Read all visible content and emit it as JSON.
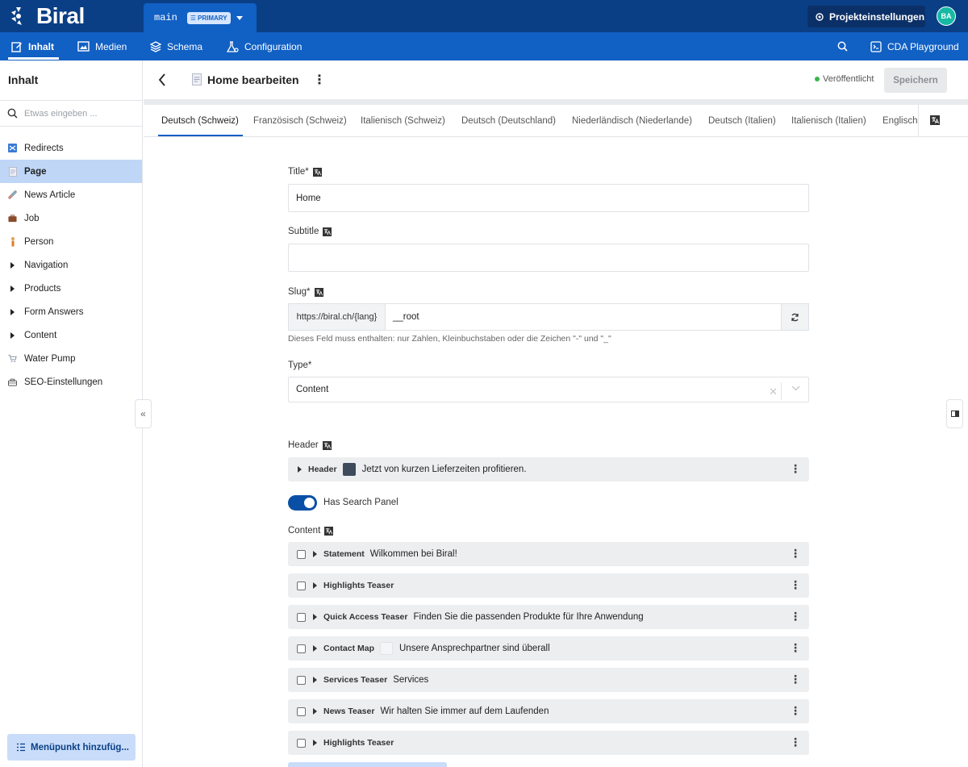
{
  "topbar": {
    "logo_text": "Biral",
    "branch_name": "main",
    "branch_badge": "PRIMARY",
    "project_settings_label": "Projekteinstellungen",
    "avatar_initials": "BA"
  },
  "nav": {
    "items": [
      {
        "label": "Inhalt",
        "icon": "edit-icon",
        "active": true
      },
      {
        "label": "Medien",
        "icon": "image-icon"
      },
      {
        "label": "Schema",
        "icon": "layers-icon"
      },
      {
        "label": "Configuration",
        "icon": "flask-icon"
      }
    ],
    "playground_label": "CDA Playground"
  },
  "sidebar": {
    "title": "Inhalt",
    "search_placeholder": "Etwas eingeben ...",
    "items": [
      {
        "label": "Redirects",
        "icon": "shuffle-icon"
      },
      {
        "label": "Page",
        "icon": "page-icon",
        "active": true
      },
      {
        "label": "News Article",
        "icon": "pill-icon"
      },
      {
        "label": "Job",
        "icon": "briefcase-icon"
      },
      {
        "label": "Person",
        "icon": "person-icon"
      },
      {
        "label": "Navigation",
        "icon": "expand-triangle"
      },
      {
        "label": "Products",
        "icon": "expand-triangle"
      },
      {
        "label": "Form Answers",
        "icon": "expand-triangle"
      },
      {
        "label": "Content",
        "icon": "expand-triangle"
      },
      {
        "label": "Water Pump",
        "icon": "cart-icon"
      },
      {
        "label": "SEO-Einstellungen",
        "icon": "toolbox-icon"
      }
    ],
    "add_menu_label": "Menüpunkt hinzufüg..."
  },
  "editor": {
    "title": "Home bearbeiten",
    "status": "Veröffentlicht",
    "save_label": "Speichern",
    "status_color": "#3bb54a"
  },
  "tabs": [
    "Deutsch (Schweiz)",
    "Französisch (Schweiz)",
    "Italienisch (Schweiz)",
    "Deutsch (Deutschland)",
    "Niederländisch (Niederlande)",
    "Deutsch (Italien)",
    "Italienisch (Italien)",
    "Englisch"
  ],
  "form": {
    "title_label": "Title*",
    "title_value": "Home",
    "subtitle_label": "Subtitle",
    "subtitle_value": "",
    "slug_label": "Slug*",
    "slug_prefix": "https://biral.ch/{lang}",
    "slug_value": "__root",
    "slug_hint": "Dieses Feld muss enthalten: nur Zahlen, Kleinbuchstaben oder die Zeichen \"-\" und \"_\"",
    "type_label": "Type*",
    "type_value": "Content",
    "header_label": "Header",
    "header_block": {
      "name": "Header",
      "text": "Jetzt von kurzen Lieferzeiten profitieren."
    },
    "search_panel_label": "Has Search Panel",
    "search_panel_on": true,
    "content_label": "Content",
    "content_blocks": [
      {
        "name": "Statement",
        "text": "Wilkommen bei Biral!"
      },
      {
        "name": "Highlights Teaser",
        "text": ""
      },
      {
        "name": "Quick Access Teaser",
        "text": "Finden Sie die passenden Produkte für Ihre Anwendung"
      },
      {
        "name": "Contact Map",
        "text": "Unsere Ansprechpartner sind überall"
      },
      {
        "name": "Services Teaser",
        "text": "Services"
      },
      {
        "name": "News Teaser",
        "text": "Wir halten Sie immer auf dem Laufenden"
      },
      {
        "name": "Highlights Teaser",
        "text": ""
      }
    ]
  },
  "colors": {
    "topbar": "#0a3f86",
    "navbar": "#1160c4",
    "accent": "#1160c4",
    "active_sidebar": "#bfd6f7"
  }
}
